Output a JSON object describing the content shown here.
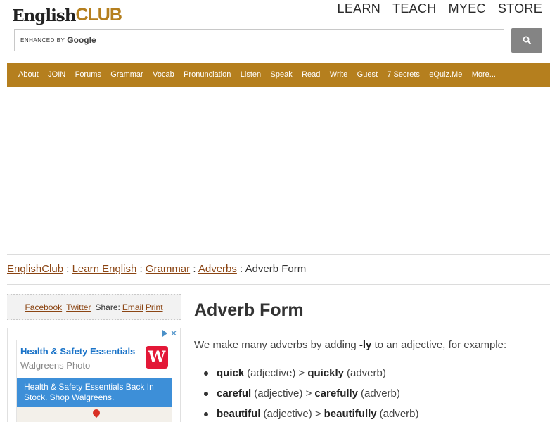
{
  "logo": {
    "part1": "English",
    "part2": "CLUB"
  },
  "topnav": [
    "LEARN",
    "TEACH",
    "MYEC",
    "STORE"
  ],
  "search": {
    "enhanced_label": "ENHANCED BY",
    "google_label": "Google",
    "button_icon": "search-icon"
  },
  "mainnav": [
    "About",
    "JOIN",
    "Forums",
    "Grammar",
    "Vocab",
    "Pronunciation",
    "Listen",
    "Speak",
    "Read",
    "Write",
    "Guest",
    "7 Secrets",
    "eQuiz.Me",
    "More..."
  ],
  "breadcrumb": {
    "items": [
      "EnglishClub",
      "Learn English",
      "Grammar",
      "Adverbs"
    ],
    "current": "Adverb Form",
    "separator": ":"
  },
  "share": {
    "facebook": "Facebook",
    "twitter": "Twitter",
    "label": "Share:",
    "email": "Email",
    "print": "Print"
  },
  "ad": {
    "title": "Health & Safety Essentials",
    "subtitle": "Walgreens Photo",
    "logo_letter": "W",
    "body": "Health & Safety Essentials Back In Stock. Shop Walgreens."
  },
  "article": {
    "title": "Adverb Form",
    "intro_before": "We make many adverbs by adding",
    "intro_suffix": "-ly",
    "intro_after": "to an adjective, for example:",
    "examples": [
      {
        "adj": "quick",
        "adj_tag": "(adjective) >",
        "adv": "quickly",
        "adv_tag": "(adverb)"
      },
      {
        "adj": "careful",
        "adj_tag": "(adjective) >",
        "adv": "carefully",
        "adv_tag": "(adverb)"
      },
      {
        "adj": "beautiful",
        "adj_tag": "(adjective) >",
        "adv": "beautifully",
        "adv_tag": "(adverb)"
      }
    ]
  },
  "colors": {
    "brand": "#b57f1e",
    "link": "#8b4513",
    "ad_blue": "#3d8fd8"
  }
}
